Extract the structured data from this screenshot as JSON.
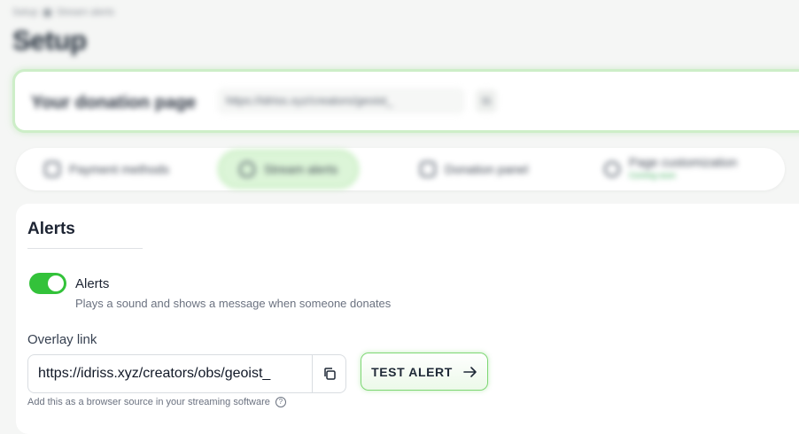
{
  "breadcrumb": {
    "parent": "Setup",
    "current": "Stream alerts"
  },
  "page_title": "Setup",
  "donation_page": {
    "label": "Your donation page",
    "url": "https://idriss.xyz/creators/geoist_"
  },
  "tabs": [
    {
      "label": "Payment methods",
      "icon": "payment-icon"
    },
    {
      "label": "Stream alerts",
      "icon": "shield-icon",
      "active": true
    },
    {
      "label": "Donation panel",
      "icon": "panel-icon"
    },
    {
      "label": "Page customization",
      "sub": "Coming soon",
      "icon": "check-icon"
    }
  ],
  "alerts": {
    "section_title": "Alerts",
    "toggle_label": "Alerts",
    "toggle_on": true,
    "toggle_description": "Plays a sound and shows a message when someone donates",
    "overlay_label": "Overlay link",
    "overlay_url": "https://idriss.xyz/creators/obs/geoist_",
    "test_button": "TEST ALERT",
    "hint": "Add this as a browser source in your streaming software"
  },
  "colors": {
    "accent": "#33c23a",
    "active_tab_bg": "#dcf5d8",
    "border_glow": "#cdeec8"
  }
}
